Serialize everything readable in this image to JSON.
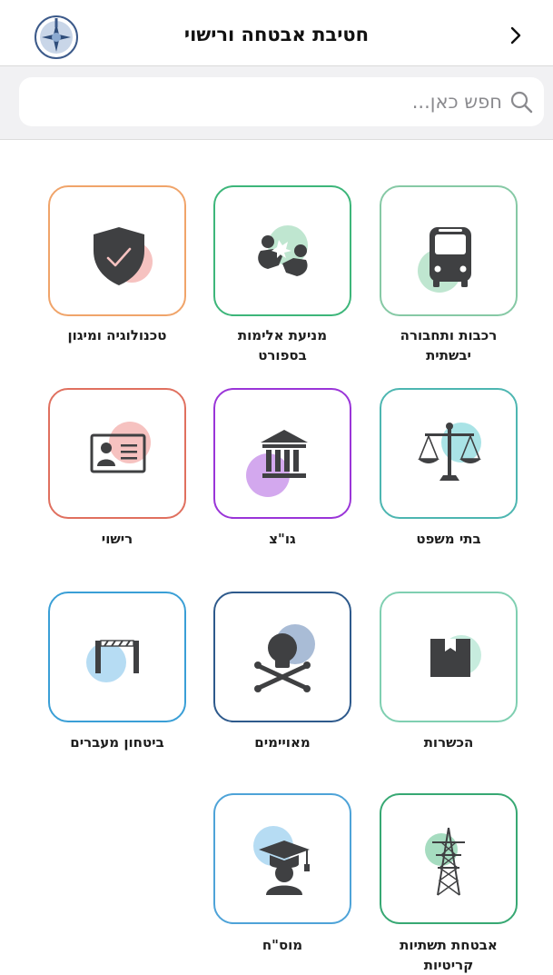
{
  "header": {
    "title": "חטיבת אבטחה ורישוי",
    "back_icon": "chevron-right-icon",
    "logo": "police-emblem-logo"
  },
  "search": {
    "placeholder": "חפש כאן...",
    "value": "",
    "icon": "search-icon"
  },
  "tiles": [
    {
      "line1": "רכבות ותחבורה",
      "line2": "יבשתית",
      "icon": "bus-icon",
      "color": "#86c9a5"
    },
    {
      "line1": "מניעת אלימות",
      "line2": "בספורט",
      "icon": "fist-fight-icon",
      "color": "#3db67a"
    },
    {
      "line1": "טכנולוגיה ומיגון",
      "line2": "",
      "icon": "shield-check-icon",
      "color": "#f0a46a"
    },
    {
      "line1": "בתי משפט",
      "line2": "",
      "icon": "scales-icon",
      "color": "#4db6b1"
    },
    {
      "line1": "גו\"צ",
      "line2": "",
      "icon": "government-building-icon",
      "color": "#9a35d8"
    },
    {
      "line1": "רישוי",
      "line2": "",
      "icon": "id-card-icon",
      "color": "#e0705f"
    },
    {
      "line1": "הכשרות",
      "line2": "",
      "icon": "box-icon",
      "color": "#7fcfb1"
    },
    {
      "line1": "מאויימים",
      "line2": "",
      "icon": "skull-crossbones-icon",
      "color": "#2e5a8c"
    },
    {
      "line1": "ביטחון מעברים",
      "line2": "",
      "icon": "barrier-gate-icon",
      "color": "#3a9fd6"
    },
    {
      "line1": "אבטחת תשתיות",
      "line2": "קריטיות",
      "icon": "power-tower-icon",
      "color": "#37a873"
    },
    {
      "line1": "מוס\"ח",
      "line2": "",
      "icon": "graduation-cap-icon",
      "color": "#4ea3d8"
    }
  ]
}
